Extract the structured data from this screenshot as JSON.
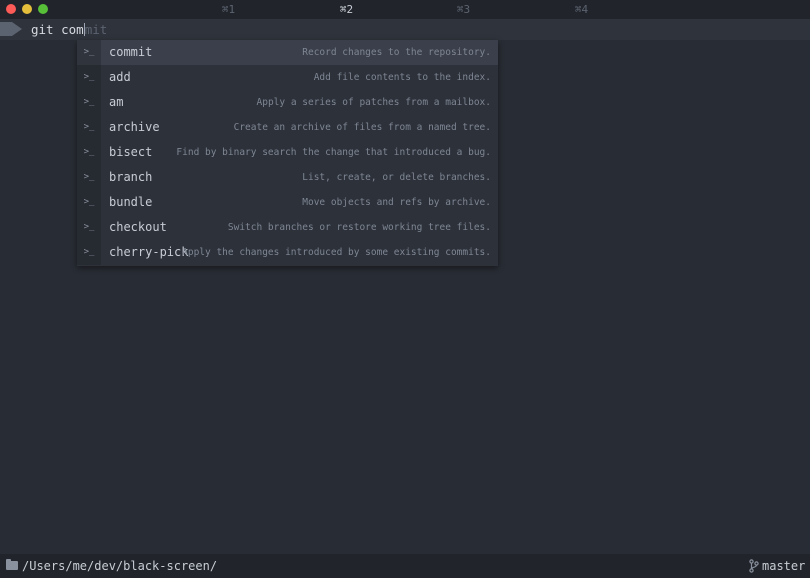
{
  "tabs": [
    {
      "label": "⌘1",
      "active": false
    },
    {
      "label": "⌘2",
      "active": true
    },
    {
      "label": "⌘3",
      "active": false
    },
    {
      "label": "⌘4",
      "active": false
    }
  ],
  "prompt": {
    "typed": "git com",
    "suggestion_rest": "mit"
  },
  "autocomplete": {
    "icon_glyph": ">_",
    "items": [
      {
        "name": "commit",
        "description": "Record changes to the repository.",
        "selected": true
      },
      {
        "name": "add",
        "description": "Add file contents to the index."
      },
      {
        "name": "am",
        "description": "Apply a series of patches from a mailbox."
      },
      {
        "name": "archive",
        "description": "Create an archive of files from a named tree."
      },
      {
        "name": "bisect",
        "description": "Find by binary search the change that introduced a bug."
      },
      {
        "name": "branch",
        "description": "List, create, or delete branches."
      },
      {
        "name": "bundle",
        "description": "Move objects and refs by archive."
      },
      {
        "name": "checkout",
        "description": "Switch branches or restore working tree files."
      },
      {
        "name": "cherry-pick",
        "description": "Apply the changes introduced by some existing commits."
      }
    ]
  },
  "statusbar": {
    "cwd": "/Users/me/dev/black-screen/",
    "branch": "master",
    "icons": [
      "folder-icon",
      "git-branch-icon"
    ]
  },
  "colors": {
    "background": "#282c34",
    "titlebar": "#21252b",
    "close": "#fc5b57",
    "minimize": "#e5bf3c",
    "maximize": "#57c038",
    "selected_row": "#3a3f4b"
  }
}
